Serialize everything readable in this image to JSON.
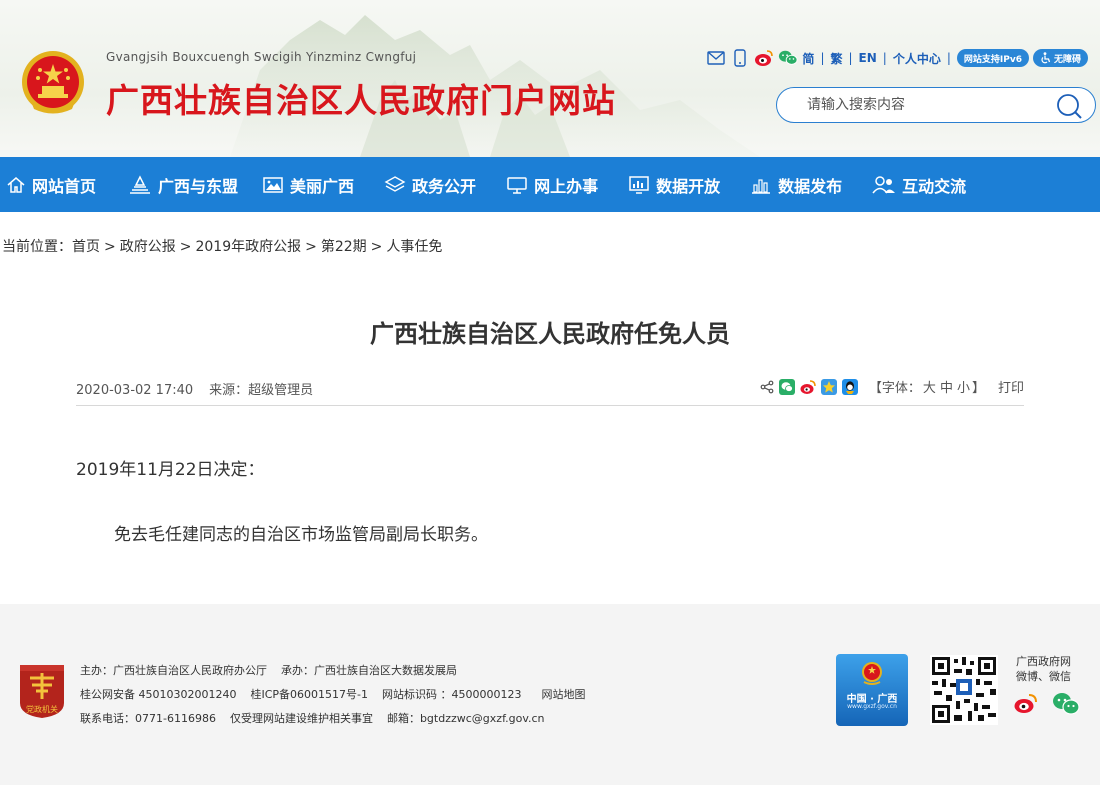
{
  "header": {
    "subtitle": "Gvangjsih Bouxcuengh Swcigih Yinzminz Cwngfuj",
    "title": "广西壮族自治区人民政府门户网站",
    "top_links": {
      "simplified": "简",
      "traditional": "繁",
      "english": "EN",
      "personal_center": "个人中心",
      "ipv6_badge": "网站支持IPv6",
      "accessibility_badge": "无障碍"
    },
    "search": {
      "placeholder": "请输入搜索内容"
    }
  },
  "nav": {
    "items": [
      {
        "label": "网站首页",
        "icon": "home-icon"
      },
      {
        "label": "广西与东盟",
        "icon": "landmark-icon"
      },
      {
        "label": "美丽广西",
        "icon": "picture-icon"
      },
      {
        "label": "政务公开",
        "icon": "layers-icon"
      },
      {
        "label": "网上办事",
        "icon": "monitor-icon"
      },
      {
        "label": "数据开放",
        "icon": "data-screen-icon"
      },
      {
        "label": "数据发布",
        "icon": "bar-chart-icon"
      },
      {
        "label": "互动交流",
        "icon": "users-icon"
      }
    ]
  },
  "breadcrumb": {
    "prefix": "当前位置：",
    "items": [
      "首页",
      "政府公报",
      "2019年政府公报",
      "第22期",
      "人事任免"
    ],
    "separator": ">"
  },
  "article": {
    "title": "广西壮族自治区人民政府任免人员",
    "date": "2020-03-02 17:40",
    "source": "来源：超级管理员",
    "font_size_prefix": "【字体：",
    "font_size_options": [
      "大",
      "中",
      "小"
    ],
    "font_size_suffix": "】",
    "print": "打印",
    "share_icons": [
      "share-icon",
      "wechat-icon",
      "weibo-icon",
      "qzone-icon",
      "qq-icon"
    ],
    "paragraphs": [
      "2019年11月22日决定：",
      "免去毛任建同志的自治区市场监管局副局长职务。"
    ]
  },
  "footer": {
    "badge": "党政机关",
    "host": "主办：广西壮族自治区人民政府办公厅",
    "organizer": "承办：广西壮族自治区大数据发展局",
    "police_record": "桂公网安备 45010302001240",
    "icp": "桂ICP备06001517号-1",
    "site_code": "网站标识码 ：4500000123",
    "sitemap": "网站地图",
    "phone": "联系电话：0771-6116986",
    "note": "仅受理网站建设维护相关事宜",
    "email": "邮箱：bgtdzzwc@gxzf.gov.cn",
    "gov_logo_text": "中国 · 广西",
    "gov_logo_url": "www.gxzf.gov.cn",
    "qr_label_line1": "广西政府网",
    "qr_label_line2": "微博、微信"
  },
  "colors": {
    "brand_red": "#d8161c",
    "nav_blue": "#1c7fd6",
    "link_blue": "#1d5fb8"
  }
}
